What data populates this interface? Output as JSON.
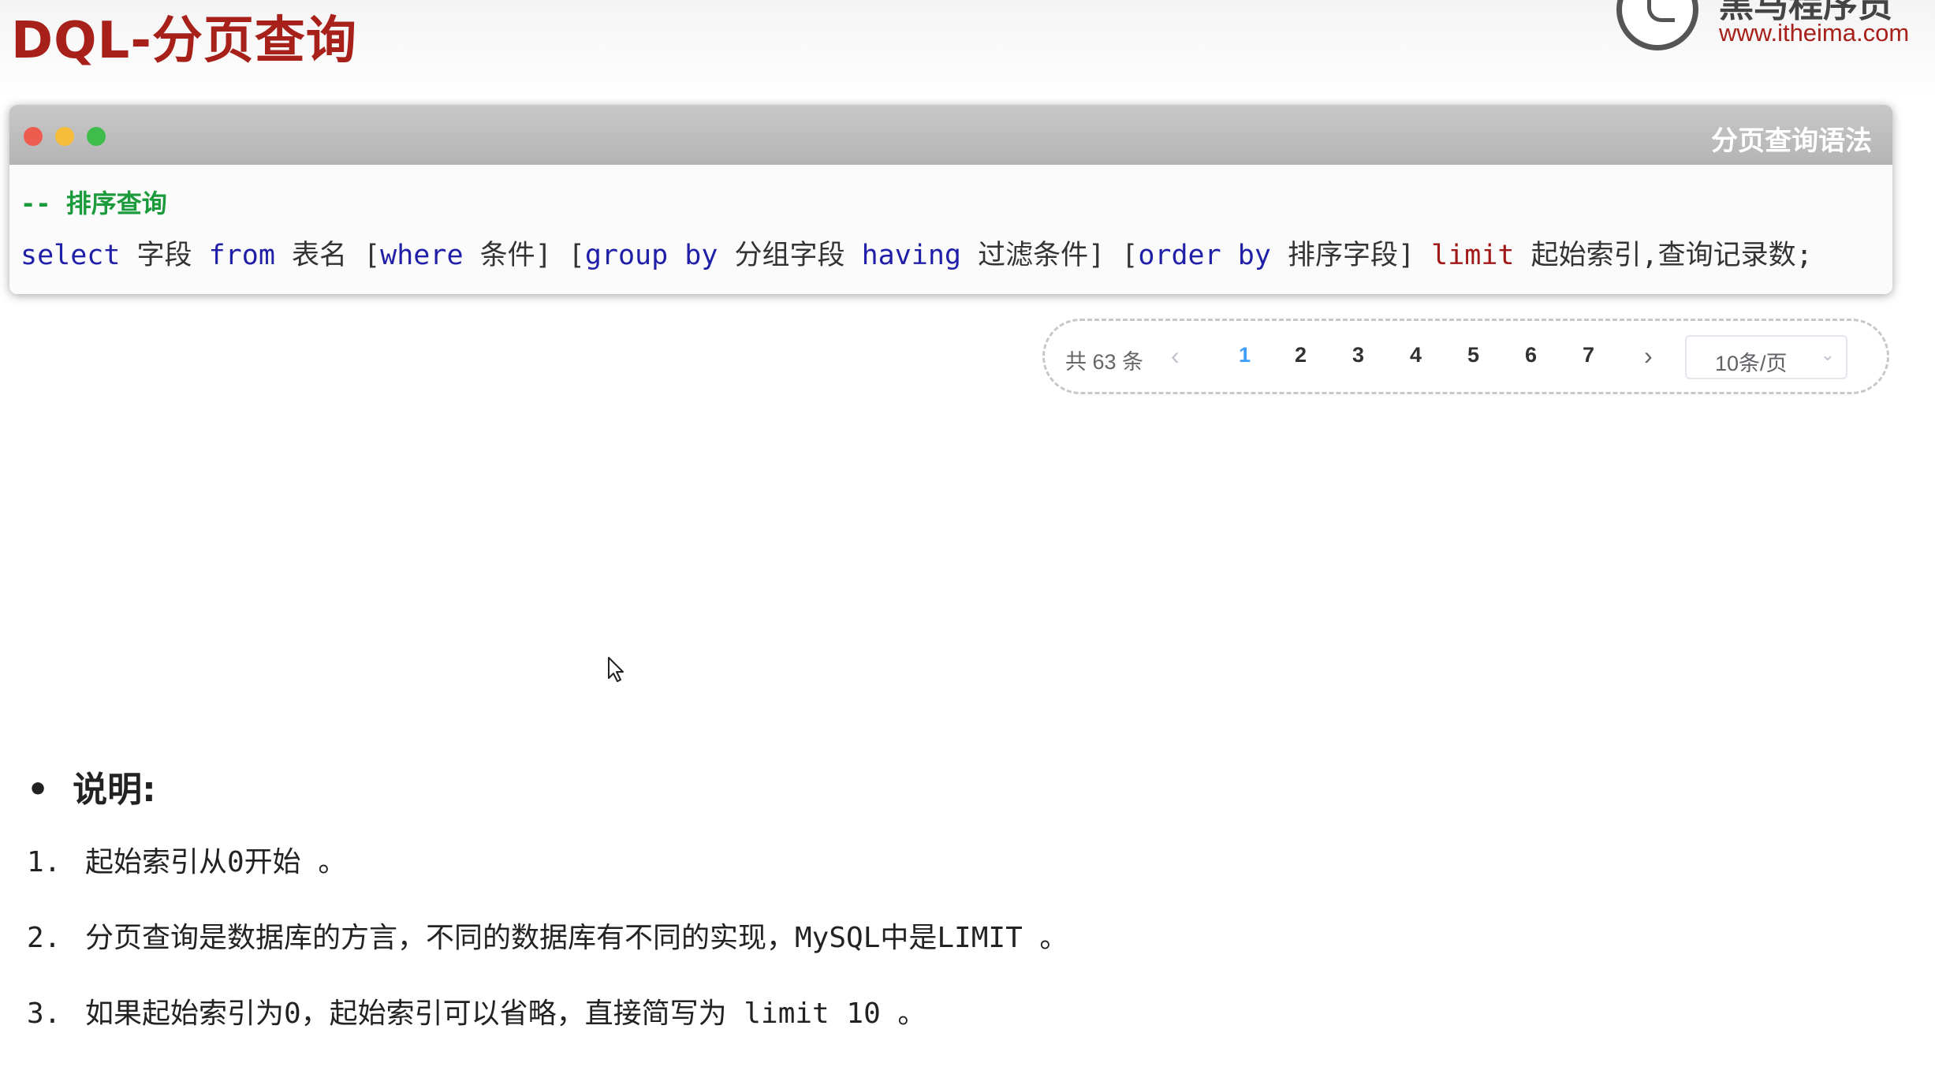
{
  "header": {
    "title": "DQL-分页查询",
    "logo_name": "黑马程序员",
    "logo_url": "www.itheima.com"
  },
  "code_window": {
    "title": "分页查询语法",
    "comment": "-- 排序查询",
    "tokens": {
      "select": "select",
      "field": "字段",
      "from": "from",
      "table": "表名",
      "where_open": "[",
      "where": "where",
      "condition": "条件]",
      "group_open": "[",
      "group_by": "group by",
      "group_field": "分组字段",
      "having": "having",
      "filter": "过滤条件]",
      "order_open": "[",
      "order_by": "order by",
      "sort_field": "排序字段]",
      "limit": "limit",
      "limit_args": "起始索引,查询记录数;"
    }
  },
  "pagination": {
    "total": "共 63 条",
    "prev_icon": "‹",
    "pages": [
      "1",
      "2",
      "3",
      "4",
      "5",
      "6",
      "7"
    ],
    "active_page": "1",
    "next_icon": "›",
    "page_size": "10条/页",
    "caret_icon": "⌄"
  },
  "notes": {
    "heading": "说明:",
    "bullet": "•",
    "items": [
      {
        "num": "1.",
        "text": "起始索引从0开始 。"
      },
      {
        "num": "2.",
        "text": "分页查询是数据库的方言，不同的数据库有不同的实现，MySQL中是LIMIT 。"
      },
      {
        "num": "3.",
        "text": "如果起始索引为0，起始索引可以省略，直接简写为 limit 10 。"
      }
    ]
  },
  "colors": {
    "title_red": "#a8201a",
    "keyword_blue": "#1f1fa8",
    "limit_red": "#a01818",
    "comment_green": "#1b9b3b",
    "active_page_blue": "#409eff"
  }
}
